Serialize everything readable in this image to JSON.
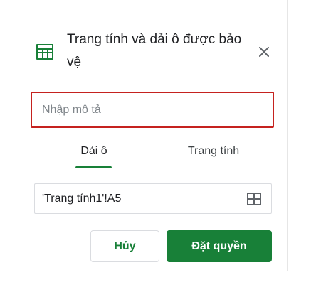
{
  "dialog": {
    "title": "Trang tính và dải ô được bảo vệ",
    "description_placeholder": "Nhập mô tả",
    "description_value": ""
  },
  "tabs": [
    {
      "label": "Dải ô",
      "active": true
    },
    {
      "label": "Trang tính",
      "active": false
    }
  ],
  "range_input": {
    "value": "'Trang tính1'!A5"
  },
  "buttons": {
    "cancel": "Hủy",
    "confirm": "Đặt quyền"
  },
  "icons": {
    "header": "sheet-grid-icon",
    "close": "close-icon",
    "range_picker": "grid-select-icon"
  },
  "colors": {
    "accent": "#188038",
    "error_border": "#c5221f"
  }
}
